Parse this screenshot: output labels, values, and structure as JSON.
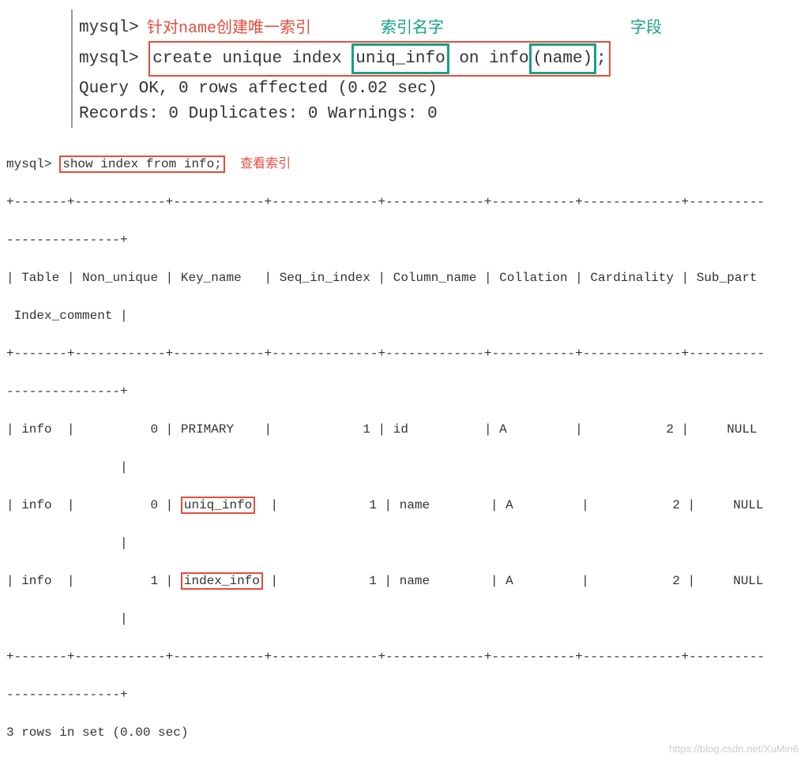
{
  "top": {
    "annotations": {
      "create_note": "针对name创建唯一索引",
      "index_name_label": "索引名字",
      "field_label": "字段"
    },
    "prompt1": "mysql>",
    "prompt2": "mysql>",
    "sql_parts": {
      "p1": "create unique index",
      "p2": "uniq_info",
      "p3": "on info",
      "p4": "(name)",
      "p5": ";"
    },
    "result_line1": "Query OK, 0 rows affected (0.02 sec)",
    "result_line2": "Records: 0  Duplicates: 0  Warnings: 0"
  },
  "bottom": {
    "prompt": "mysql>",
    "sql": "show index from info;",
    "annotation": "查看索引",
    "separator_top": "+-------+------------+------------+--------------+-------------+-----------+-------------+----------",
    "separator_sub": "---------------+",
    "headers": {
      "table": "Table",
      "non_unique": "Non_unique",
      "key_name": "Key_name",
      "seq_in_index": "Seq_in_index",
      "column_name": "Column_name",
      "collation": "Collation",
      "cardinality": "Cardinality",
      "sub_part": "Sub_part",
      "index_comment": "Index_comment"
    },
    "rows": [
      {
        "table": "info",
        "non_unique": "0",
        "key_name": "PRIMARY",
        "seq_in_index": "1",
        "column_name": "id",
        "collation": "A",
        "cardinality": "2",
        "sub_part": "NULL",
        "boxed": false
      },
      {
        "table": "info",
        "non_unique": "0",
        "key_name": "uniq_info",
        "seq_in_index": "1",
        "column_name": "name",
        "collation": "A",
        "cardinality": "2",
        "sub_part": "NULL",
        "boxed": true
      },
      {
        "table": "info",
        "non_unique": "1",
        "key_name": "index_info",
        "seq_in_index": "1",
        "column_name": "name",
        "collation": "A",
        "cardinality": "2",
        "sub_part": "NULL",
        "boxed": true
      }
    ],
    "footer": "3 rows in set (0.00 sec)"
  },
  "watermark": "https://blog.csdn.net/XuMin6"
}
